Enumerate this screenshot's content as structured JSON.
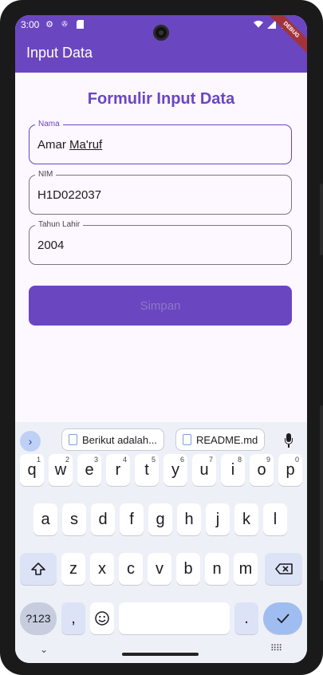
{
  "status_bar": {
    "time": "3:00",
    "icons": [
      "settings-icon",
      "nfc-icon",
      "sd-card-icon",
      "wifi-icon",
      "signal-icon",
      "battery-icon"
    ]
  },
  "app_bar": {
    "title": "Input Data",
    "debug_banner": "DEBUG",
    "color": "#6b46c1"
  },
  "form": {
    "title": "Formulir Input Data",
    "fields": [
      {
        "label": "Nama",
        "value_plain": "Amar ",
        "value_underlined": "Ma'ruf",
        "focused": true
      },
      {
        "label": "NIM",
        "value": "H1D022037",
        "focused": false
      },
      {
        "label": "Tahun Lahir",
        "value": "2004",
        "focused": false
      }
    ],
    "submit_label": "Simpan"
  },
  "keyboard": {
    "suggestions": [
      "Berikut adalah...",
      "README.md"
    ],
    "rows": [
      [
        [
          "q",
          "1"
        ],
        [
          "w",
          "2"
        ],
        [
          "e",
          "3"
        ],
        [
          "r",
          "4"
        ],
        [
          "t",
          "5"
        ],
        [
          "y",
          "6"
        ],
        [
          "u",
          "7"
        ],
        [
          "i",
          "8"
        ],
        [
          "o",
          "9"
        ],
        [
          "p",
          "0"
        ]
      ],
      [
        [
          "a",
          ""
        ],
        [
          "s",
          ""
        ],
        [
          "d",
          ""
        ],
        [
          "f",
          ""
        ],
        [
          "g",
          ""
        ],
        [
          "h",
          ""
        ],
        [
          "j",
          ""
        ],
        [
          "k",
          ""
        ],
        [
          "l",
          ""
        ]
      ],
      [
        [
          "z",
          ""
        ],
        [
          "x",
          ""
        ],
        [
          "c",
          ""
        ],
        [
          "v",
          ""
        ],
        [
          "b",
          ""
        ],
        [
          "n",
          ""
        ],
        [
          "m",
          ""
        ]
      ]
    ],
    "symbols_label": "?123",
    "comma_label": ",",
    "period_label": "."
  },
  "colors": {
    "accent": "#6b46c1",
    "background": "#fdf7ff",
    "keyboard_bg": "#eef0f8",
    "enter_key": "#9fbdf0"
  }
}
